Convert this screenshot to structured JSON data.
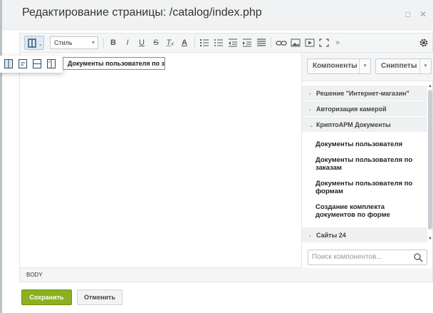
{
  "dialog": {
    "title": "Редактирование страницы: /catalog/index.php",
    "collapse_icon": "square-icon",
    "close_icon": "close-icon"
  },
  "toolbar": {
    "style_select": "Стиль",
    "more": "»",
    "buttons": [
      "bold",
      "italic",
      "underline",
      "strike",
      "clear-format",
      "font-color",
      "ordered-list",
      "unordered-list",
      "outdent",
      "indent",
      "align",
      "link",
      "image",
      "video",
      "fullscreen"
    ]
  },
  "view_popup": {
    "icons": [
      "code-and-editor-icon",
      "code-icon",
      "horizontal-split-icon",
      "vertical-split-icon"
    ]
  },
  "tooltip": {
    "text": "Документы пользователя по заказам"
  },
  "sidepanel": {
    "tab_components": "Компоненты",
    "tab_snippets": "Сниппеты",
    "groups": [
      "Решение \"Интернет-магазин\"",
      "Авторизация камерой",
      "КриптоАРМ Документы"
    ],
    "items": [
      "Документы пользователя",
      "Документы пользователя по заказам",
      "Документы пользователя по формам",
      "Создание комплекта документов по форме"
    ],
    "group_last": "Сайты 24",
    "search_placeholder": "Поиск компонентов..."
  },
  "statusbar": {
    "path": "BODY"
  },
  "footer": {
    "save_label": "Сохранить",
    "cancel_label": "Отменить"
  },
  "colors": {
    "save_bg": "#8bb020",
    "toolbar_bg": "#f4f5f6"
  }
}
